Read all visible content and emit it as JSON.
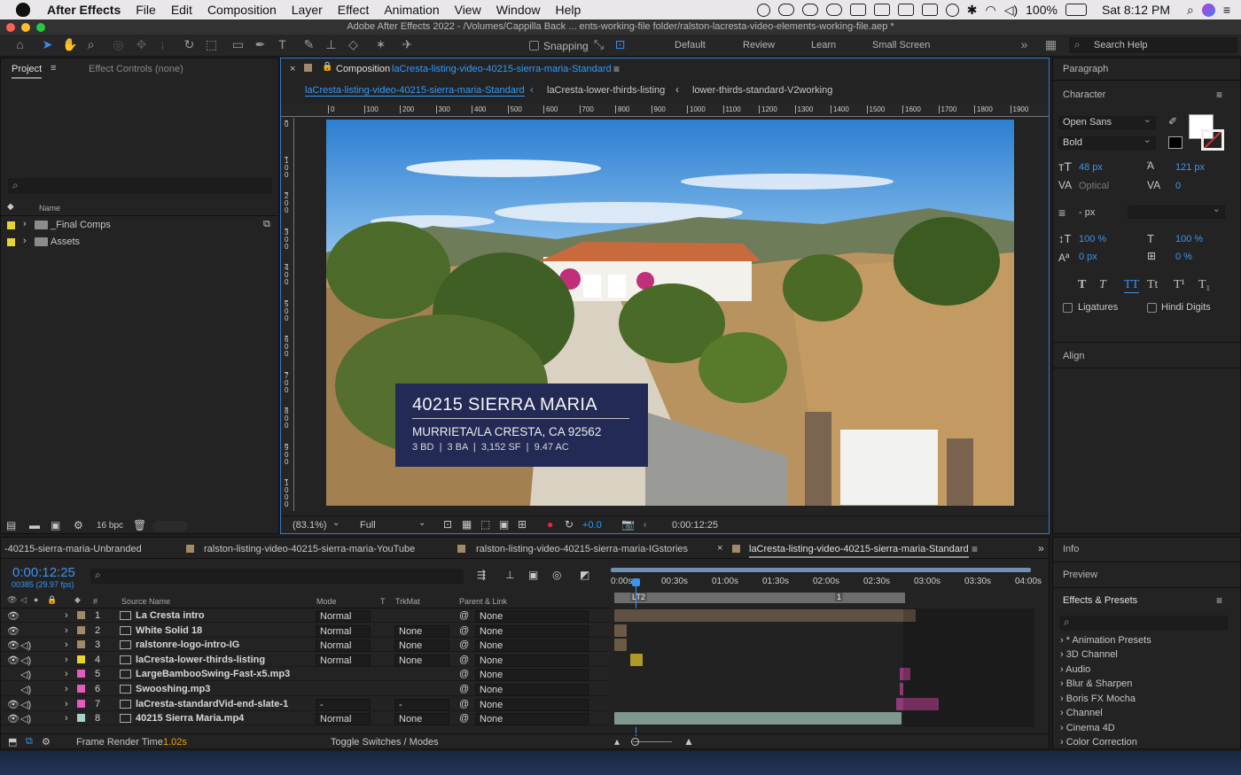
{
  "menubar": {
    "app": "After Effects",
    "items": [
      "File",
      "Edit",
      "Composition",
      "Layer",
      "Effect",
      "Animation",
      "View",
      "Window",
      "Help"
    ],
    "battery": "100%",
    "clock": "Sat 8:12 PM"
  },
  "window": {
    "title": "Adobe After Effects 2022 - /Volumes/Cappilla Back ... ents-working-file folder/ralston-lacresta-video-elements-working-file.aep *"
  },
  "toolbar": {
    "snapping": "Snapping",
    "workspaces": [
      "Default",
      "Review",
      "Learn",
      "Small Screen"
    ],
    "search_help": "Search Help"
  },
  "project": {
    "tab_project": "Project",
    "tab_effect_controls": "Effect Controls (none)",
    "col_name": "Name",
    "items": [
      {
        "name": "_Final Comps",
        "color": "#e5d431"
      },
      {
        "name": "Assets",
        "color": "#e5d431"
      }
    ],
    "bpc": "16 bpc"
  },
  "composition": {
    "label": "Composition",
    "comp_name": "laCresta-listing-video-40215-sierra-maria-Standard",
    "breadcrumbs": [
      "laCresta-listing-video-40215-sierra-maria-Standard",
      "laCresta-lower-thirds-listing",
      "lower-thirds-standard-V2working"
    ],
    "ruler": [
      "0",
      "100",
      "200",
      "300",
      "400",
      "500",
      "600",
      "700",
      "800",
      "900",
      "1000",
      "1100",
      "1200",
      "1300",
      "1400",
      "1500",
      "1600",
      "1700",
      "1800",
      "1900"
    ],
    "vruler": [
      "0",
      "100",
      "200",
      "300",
      "400",
      "500",
      "600",
      "700",
      "800",
      "900",
      "1000"
    ],
    "zoom": "(83.1%)",
    "resolution": "Full",
    "exposure": "+0.0",
    "timecode": "0:00:12:25"
  },
  "lower_third": {
    "address": "40215 SIERRA MARIA",
    "city": "MURRIETA/LA CRESTA, CA 92562",
    "details": "3 BD  |  3 BA  |  3,152 SF  |  9.47 AC",
    "bg": "#232a55"
  },
  "character": {
    "paragraph": "Paragraph",
    "title": "Character",
    "font": "Open Sans",
    "style": "Bold",
    "size": "48 px",
    "leading": "121 px",
    "kerning": "Optical",
    "tracking": "0",
    "stroke": "- px",
    "vscale": "100 %",
    "hscale": "100 %",
    "baseline": "0 px",
    "tsume": "0 %",
    "ligatures": "Ligatures",
    "hindi": "Hindi Digits",
    "align": "Align",
    "styles": [
      "T",
      "T",
      "TT",
      "Tt",
      "T¹",
      "T₁"
    ]
  },
  "timeline": {
    "tabs": [
      "-40215-sierra-maria-Unbranded",
      "ralston-listing-video-40215-sierra-maria-YouTube",
      "ralston-listing-video-40215-sierra-maria-IGstories",
      "laCresta-listing-video-40215-sierra-maria-Standard"
    ],
    "timecode": "0:00:12:25",
    "fps": "00385 (29.97 fps)",
    "cols": {
      "num": "#",
      "source": "Source Name",
      "mode": "Mode",
      "t": "T",
      "trkmat": "TrkMat",
      "parent": "Parent & Link"
    },
    "ruler": [
      "0:00s",
      "00:30s",
      "01:00s",
      "01:30s",
      "02:00s",
      "02:30s",
      "03:00s",
      "03:30s",
      "04:00s"
    ],
    "markers": [
      "LT2",
      "1"
    ],
    "layers": [
      {
        "num": "1",
        "name": "La Cresta intro",
        "color": "#a08a6a",
        "mode": "Normal",
        "trkmat": "",
        "parent": "None"
      },
      {
        "num": "2",
        "name": "White Solid 18",
        "color": "#a08a6a",
        "mode": "Normal",
        "trkmat": "None",
        "parent": "None"
      },
      {
        "num": "3",
        "name": "ralstonre-logo-intro-IG",
        "color": "#a08a6a",
        "mode": "Normal",
        "trkmat": "None",
        "parent": "None"
      },
      {
        "num": "4",
        "name": "laCresta-lower-thirds-listing",
        "color": "#e3d72e",
        "mode": "Normal",
        "trkmat": "None",
        "parent": "None"
      },
      {
        "num": "5",
        "name": "LargeBambooSwing-Fast-x5.mp3",
        "color": "#e75bbd",
        "mode": "",
        "trkmat": "",
        "parent": "None"
      },
      {
        "num": "6",
        "name": "Swooshing.mp3",
        "color": "#e75bbd",
        "mode": "",
        "trkmat": "",
        "parent": "None"
      },
      {
        "num": "7",
        "name": "laCresta-standardVid-end-slate-1",
        "color": "#e75bbd",
        "mode": "-",
        "trkmat": "-",
        "parent": "None"
      },
      {
        "num": "8",
        "name": "40215 Sierra Maria.mp4",
        "color": "#a3d3c8",
        "mode": "Normal",
        "trkmat": "None",
        "parent": "None"
      }
    ],
    "render_label": "Frame Render Time",
    "render_time": "1.02s",
    "toggle": "Toggle Switches / Modes"
  },
  "right": {
    "info": "Info",
    "preview": "Preview",
    "effects": "Effects & Presets",
    "effects_items": [
      "* Animation Presets",
      "3D Channel",
      "Audio",
      "Blur & Sharpen",
      "Boris FX Mocha",
      "Channel",
      "Cinema 4D",
      "Color Correction"
    ]
  }
}
